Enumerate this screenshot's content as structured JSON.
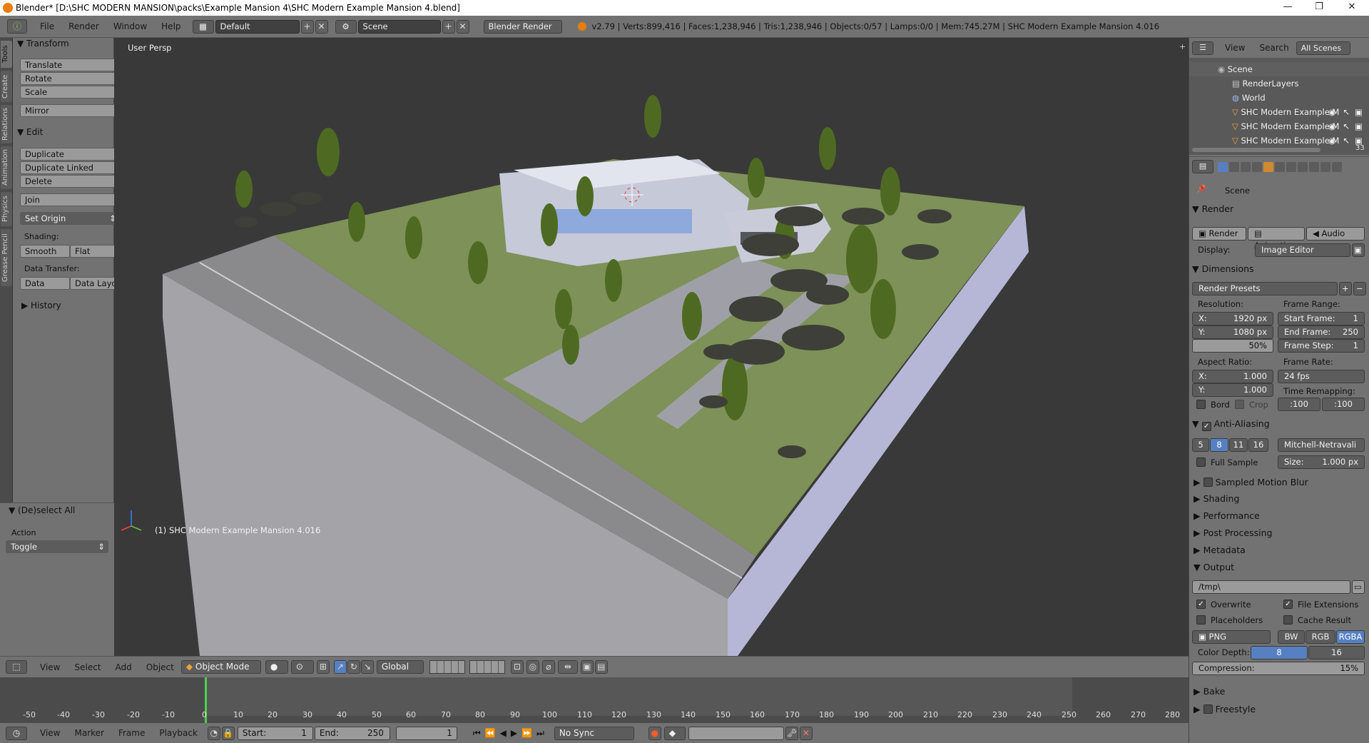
{
  "titlebar": {
    "title": "Blender* [D:\\SHC MODERN MANSION\\packs\\Example Mansion 4\\SHC Modern Example Mansion 4.blend]",
    "minimize": "—",
    "maximize": "❐",
    "close": "✕"
  },
  "topbar": {
    "menus": [
      "File",
      "Render",
      "Window",
      "Help"
    ],
    "screen_layout": "Default",
    "scene": "Scene",
    "engine": "Blender Render",
    "stats": "v2.79 | Verts:899,416 | Faces:1,238,946 | Tris:1,238,946 | Objects:0/57 | Lamps:0/0 | Mem:745.27M | SHC Modern Example Mansion 4.016"
  },
  "tool_tabs": [
    "Tools",
    "Create",
    "Relations",
    "Animation",
    "Physics",
    "Grease Pencil"
  ],
  "toolshelf": {
    "transform_title": "Transform",
    "translate": "Translate",
    "rotate": "Rotate",
    "scale": "Scale",
    "mirror": "Mirror",
    "edit_title": "Edit",
    "duplicate": "Duplicate",
    "duplicate_linked": "Duplicate Linked",
    "delete": "Delete",
    "join": "Join",
    "set_origin": "Set Origin",
    "shading_label": "Shading:",
    "smooth": "Smooth",
    "flat": "Flat",
    "data_transfer_label": "Data Transfer:",
    "data": "Data",
    "data_layout": "Data Layo",
    "history_title": "History",
    "operator_title": "(De)select All",
    "action_label": "Action",
    "action_value": "Toggle"
  },
  "viewport": {
    "label": "User Persp",
    "object_label": "(1) SHC Modern Example Mansion 4.016"
  },
  "view3d_header": {
    "menus": [
      "View",
      "Select",
      "Add",
      "Object"
    ],
    "mode": "Object Mode",
    "orientation": "Global"
  },
  "timeline": {
    "ticks": [
      "-50",
      "-40",
      "-30",
      "-20",
      "-10",
      "0",
      "10",
      "20",
      "30",
      "40",
      "50",
      "60",
      "70",
      "80",
      "90",
      "100",
      "110",
      "120",
      "130",
      "140",
      "150",
      "160",
      "170",
      "180",
      "190",
      "200",
      "210",
      "220",
      "230",
      "240",
      "250",
      "260",
      "270",
      "280"
    ],
    "current_frame": 1
  },
  "timeline_header": {
    "menus": [
      "View",
      "Marker",
      "Frame",
      "Playback"
    ],
    "start": "Start:",
    "start_value": "1",
    "end": "End:",
    "end_value": "250",
    "current": "1",
    "sync": "No Sync"
  },
  "outliner": {
    "header_menus": [
      "View",
      "Search"
    ],
    "filter": "All Scenes",
    "rows": [
      "Scene",
      "RenderLayers",
      "World",
      "SHC Modern Example M",
      "SHC Modern Example M",
      "SHC Modern Example M"
    ],
    "scroll_count": "33"
  },
  "properties": {
    "context": "Scene",
    "render_title": "Render",
    "render_btn": "Render",
    "animation_btn": "Animation",
    "audio_btn": "Audio",
    "display_label": "Display:",
    "display_value": "Image Editor",
    "dimensions_title": "Dimensions",
    "render_presets": "Render Presets",
    "resolution_label": "Resolution:",
    "res_x_label": "X:",
    "res_x": "1920 px",
    "res_y_label": "Y:",
    "res_y": "1080 px",
    "res_pct": "50%",
    "frame_range_label": "Frame Range:",
    "start_frame_label": "Start Frame:",
    "start_frame": "1",
    "end_frame_label": "End Frame:",
    "end_frame": "250",
    "frame_step_label": "Frame Step:",
    "frame_step": "1",
    "aspect_label": "Aspect Ratio:",
    "aspect_x_label": "X:",
    "aspect_x": "1.000",
    "aspect_y_label": "Y:",
    "aspect_y": "1.000",
    "frame_rate_label": "Frame Rate:",
    "frame_rate": "24 fps",
    "time_remap_label": "Time Remapping:",
    "remap_old": ":100",
    "remap_new": ":100",
    "bord": "Bord",
    "crop": "Crop",
    "aa_title": "Anti-Aliasing",
    "aa_samples": [
      "5",
      "8",
      "11",
      "16"
    ],
    "aa_filter": "Mitchell-Netravali",
    "full_sample": "Full Sample",
    "size_label": "Size:",
    "size_value": "1.000 px",
    "smb_title": "Sampled Motion Blur",
    "shading_title": "Shading",
    "performance_title": "Performance",
    "post_title": "Post Processing",
    "metadata_title": "Metadata",
    "output_title": "Output",
    "output_path": "/tmp\\",
    "overwrite": "Overwrite",
    "file_ext": "File Extensions",
    "placeholders": "Placeholders",
    "cache_result": "Cache Result",
    "format": "PNG",
    "bw": "BW",
    "rgb": "RGB",
    "rgba": "RGBA",
    "color_depth_label": "Color Depth:",
    "depth_8": "8",
    "depth_16": "16",
    "compression_label": "Compression:",
    "compression": "15%",
    "bake_title": "Bake",
    "freestyle_title": "Freestyle"
  }
}
